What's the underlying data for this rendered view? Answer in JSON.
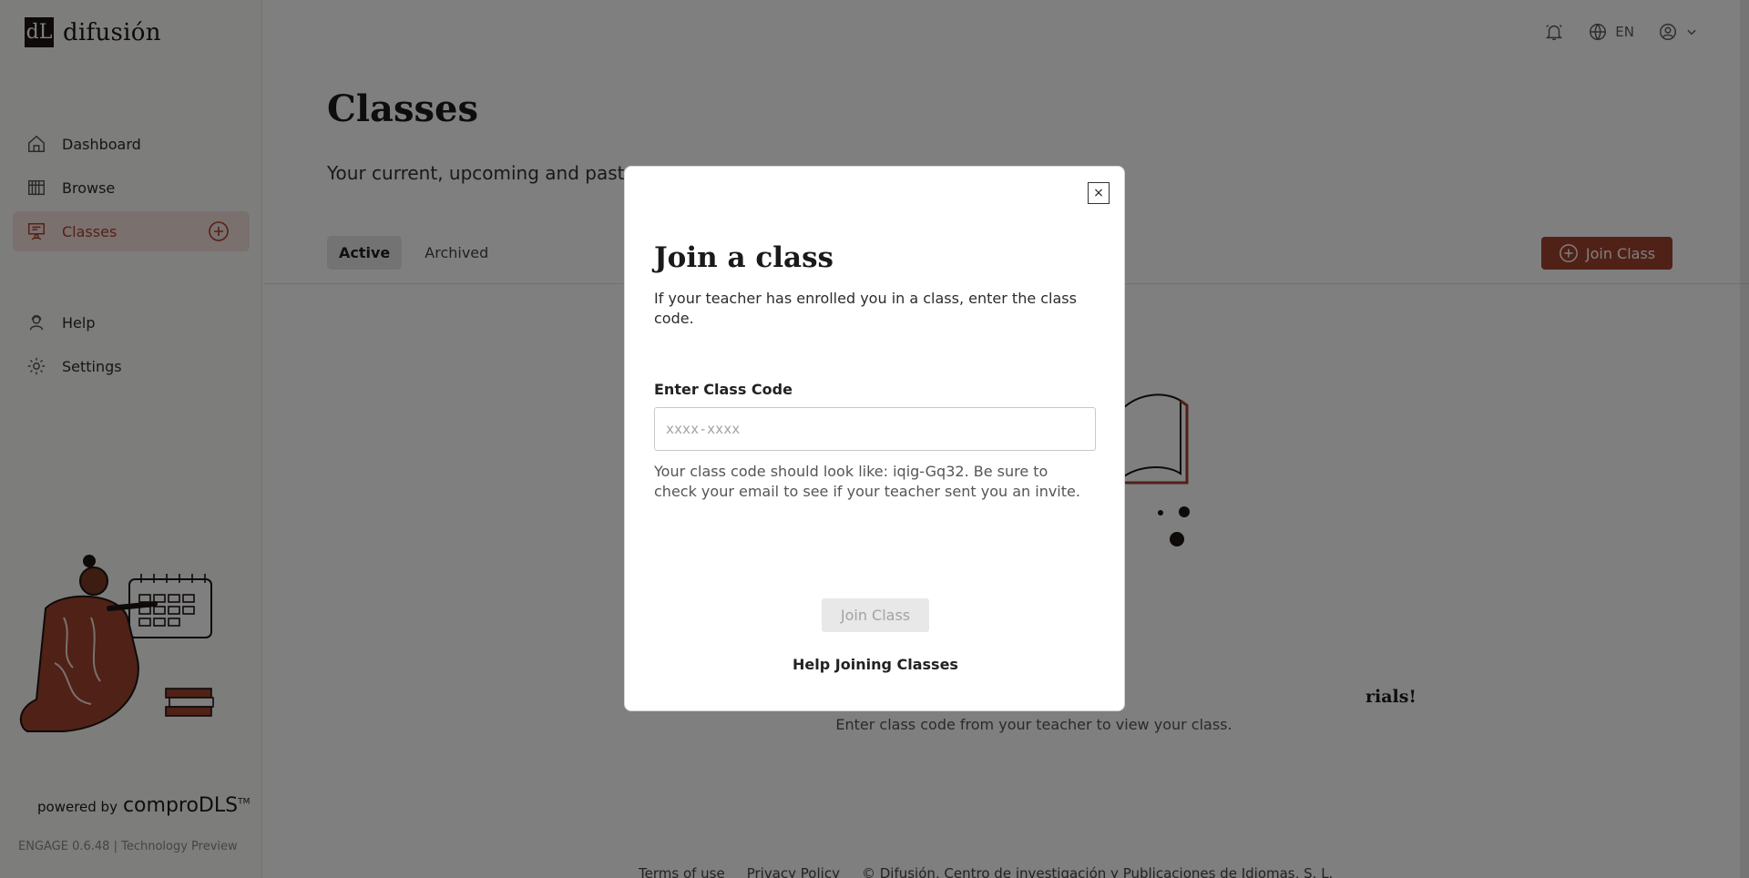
{
  "brand": {
    "logo_mark": "dL",
    "name": "difusión"
  },
  "sidebar": {
    "items": [
      {
        "label": "Dashboard",
        "icon": "home-icon"
      },
      {
        "label": "Browse",
        "icon": "library-icon"
      },
      {
        "label": "Classes",
        "icon": "classroom-icon",
        "active": true
      },
      {
        "label": "Help",
        "icon": "help-desk-icon"
      },
      {
        "label": "Settings",
        "icon": "gear-icon"
      }
    ],
    "powered_by": "powered by",
    "powered_brand": "comproDLS",
    "trademark": "TM",
    "version": "ENGAGE 0.6.48 | Technology Preview"
  },
  "topbar": {
    "language": "EN"
  },
  "main": {
    "title": "Classes",
    "subtitle": "Your current, upcoming and past",
    "tabs": [
      {
        "label": "Active",
        "active": true
      },
      {
        "label": "Archived"
      }
    ],
    "join_button": "Join Class",
    "empty_title": "rials!",
    "empty_subtitle": "Enter class code from your teacher to view your class.",
    "footer": [
      "Terms of use",
      "Privacy Policy",
      "© Difusión, Centro de investigación y Publicaciones de Idiomas, S. L."
    ]
  },
  "modal": {
    "close_label": "×",
    "title": "Join a class",
    "description": "If your teacher has enrolled you in a class, enter the class code.",
    "field_label": "Enter Class Code",
    "placeholder": "xxxx-xxxx",
    "hint": "Your class code should look like: iqig-Gq32. Be sure to check your email to see if your teacher sent you an invite.",
    "submit_label": "Join Class",
    "help_link": "Help Joining Classes"
  },
  "colors": {
    "accent": "#a0432d",
    "active_bg": "#f4e1dc",
    "overlay": "rgba(0,0,0,0.5)"
  }
}
